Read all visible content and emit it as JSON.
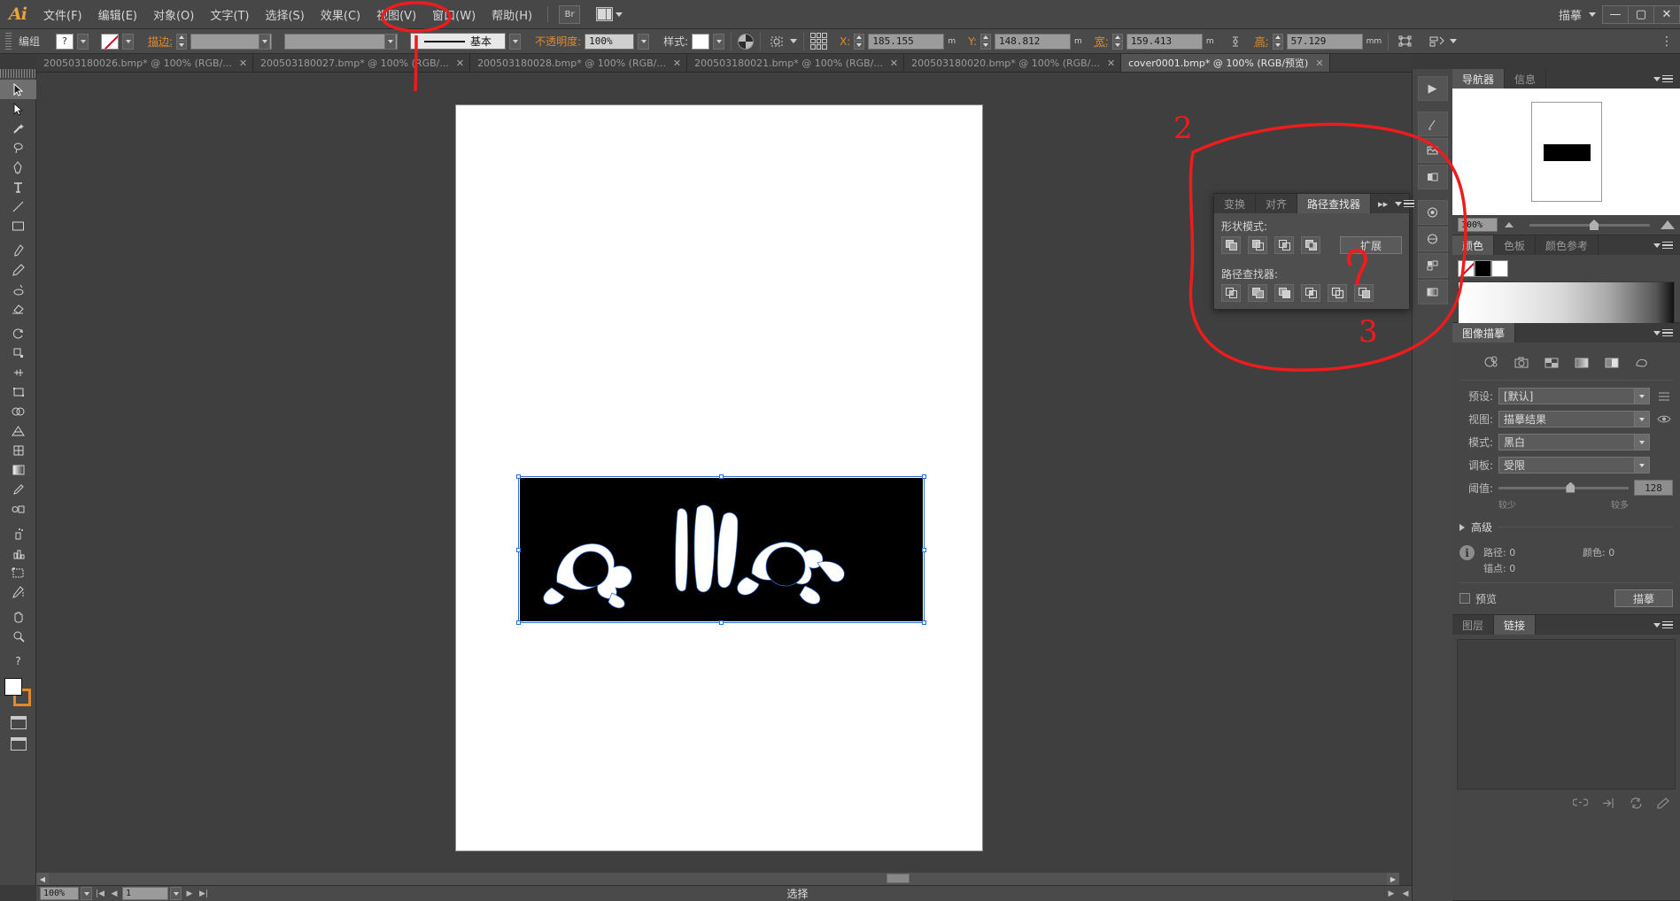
{
  "app": {
    "logo": "Ai",
    "workspace": "描摹",
    "menus": [
      "文件(F)",
      "编辑(E)",
      "对象(O)",
      "文字(T)",
      "选择(S)",
      "效果(C)",
      "视图(V)",
      "窗口(W)",
      "帮助(H)"
    ],
    "bridge_label": "Br",
    "window_buttons": {
      "minimize": "—",
      "maximize": "▢",
      "close": "✕"
    }
  },
  "control_bar": {
    "object_label": "编组",
    "fill_swatch": "?",
    "stroke_label": "描边:",
    "stroke_weight": "",
    "stroke_profile": "",
    "brush_label": "基本",
    "opacity_label": "不透明度:",
    "opacity_value": "100%",
    "style_label": "样式:",
    "x_label": "X:",
    "x_value": "185.155",
    "x_unit": "m",
    "y_label": "Y:",
    "y_value": "148.812",
    "y_unit": "m",
    "w_label": "宽:",
    "w_value": "159.413",
    "w_unit": "m",
    "h_label": "高:",
    "h_value": "57.129",
    "h_unit": "mm",
    "overflow": "⋮"
  },
  "document_tabs": [
    {
      "label": "200503180026.bmp* @ 100% (RGB/...",
      "close": "✕",
      "active": false
    },
    {
      "label": "200503180027.bmp* @ 100% (RGB/...",
      "close": "✕",
      "active": false
    },
    {
      "label": "200503180028.bmp* @ 100% (RGB/...",
      "close": "✕",
      "active": false
    },
    {
      "label": "200503180021.bmp* @ 100% (RGB/...",
      "close": "✕",
      "active": false
    },
    {
      "label": "200503180020.bmp* @ 100% (RGB/...",
      "close": "✕",
      "active": false
    },
    {
      "label": "cover0001.bmp* @ 100% (RGB/预览)",
      "close": "✕",
      "active": true
    }
  ],
  "toolbar": {
    "tools": [
      "selection-tool",
      "direct-selection-tool",
      "magic-wand-tool",
      "lasso-tool",
      "pen-tool",
      "type-tool",
      "line-segment-tool",
      "rectangle-tool",
      "paintbrush-tool",
      "pencil-tool",
      "blob-brush-tool",
      "eraser-tool",
      "rotate-tool",
      "scale-tool",
      "width-tool",
      "free-transform-tool",
      "shape-builder-tool",
      "perspective-grid-tool",
      "mesh-tool",
      "gradient-tool",
      "eyedropper-tool",
      "blend-tool",
      "symbol-sprayer-tool",
      "column-graph-tool",
      "artboard-tool",
      "slice-tool",
      "hand-tool",
      "zoom-tool"
    ],
    "fill_color": "#ffffff",
    "stroke_color": "#e08a2e"
  },
  "canvas": {
    "artboard_bg": "#ffffff",
    "artwork_bg": "#000000",
    "selection_color": "#2b6fd6"
  },
  "status_bar": {
    "zoom": "100%",
    "page": "1",
    "status_text": "选择",
    "first": "|◀",
    "prev": "◀",
    "next": "▶",
    "last": "▶|"
  },
  "pathfinder_panel": {
    "tabs": [
      {
        "label": "变换",
        "active": false
      },
      {
        "label": "对齐",
        "active": false
      },
      {
        "label": "路径查找器",
        "active": true
      }
    ],
    "shape_modes_label": "形状模式:",
    "shape_mode_buttons": [
      "unite-icon",
      "minus-front-icon",
      "intersect-icon",
      "exclude-icon"
    ],
    "expand_label": "扩展",
    "pathfinders_label": "路径查找器:",
    "pathfinder_buttons": [
      "divide-icon",
      "trim-icon",
      "merge-icon",
      "crop-icon",
      "outline-icon",
      "minus-back-icon"
    ]
  },
  "navigator_panel": {
    "tabs": [
      {
        "label": "导航器",
        "active": true
      },
      {
        "label": "信息",
        "active": false
      }
    ],
    "zoom_value": "100%"
  },
  "color_panel": {
    "tabs": [
      {
        "label": "颜色",
        "active": true
      },
      {
        "label": "色板",
        "active": false
      },
      {
        "label": "颜色参考",
        "active": false
      }
    ],
    "swatches": [
      "none",
      "#000000",
      "#ffffff"
    ]
  },
  "image_trace_panel": {
    "tabs": [
      {
        "label": "图像描摹",
        "active": true
      }
    ],
    "preset_icons": [
      "auto-color-icon",
      "high-fidelity-photo-icon",
      "low-fidelity-photo-icon",
      "grayscale-icon",
      "black-white-icon",
      "outline-icon"
    ],
    "fields": [
      {
        "label": "预设:",
        "value": "[默认]",
        "side_icon": "preset-menu-icon"
      },
      {
        "label": "视图:",
        "value": "描摹结果",
        "side_icon": "eye-icon"
      },
      {
        "label": "模式:",
        "value": "黑白",
        "side_icon": ""
      },
      {
        "label": "调板:",
        "value": "受限",
        "side_icon": ""
      }
    ],
    "threshold_label": "阈值:",
    "threshold_value": "128",
    "threshold_min_label": "较少",
    "threshold_max_label": "较多",
    "advanced_label": "高级",
    "stats": [
      {
        "label": "路径:",
        "value": "0"
      },
      {
        "label": "颜色:",
        "value": "0"
      },
      {
        "label": "锚点:",
        "value": "0"
      }
    ],
    "preview_label": "预览",
    "trace_button": "描摹"
  },
  "links_panel": {
    "tabs": [
      {
        "label": "图层",
        "active": false
      },
      {
        "label": "链接",
        "active": true
      }
    ],
    "footer_icons": [
      "link-icon",
      "goto-link-icon",
      "relink-icon",
      "edit-icon"
    ]
  },
  "annotations": {
    "circle_menu_label": "",
    "number_2": "2",
    "number_1": "1",
    "number_3": "3",
    "color": "#ee1c1c"
  }
}
